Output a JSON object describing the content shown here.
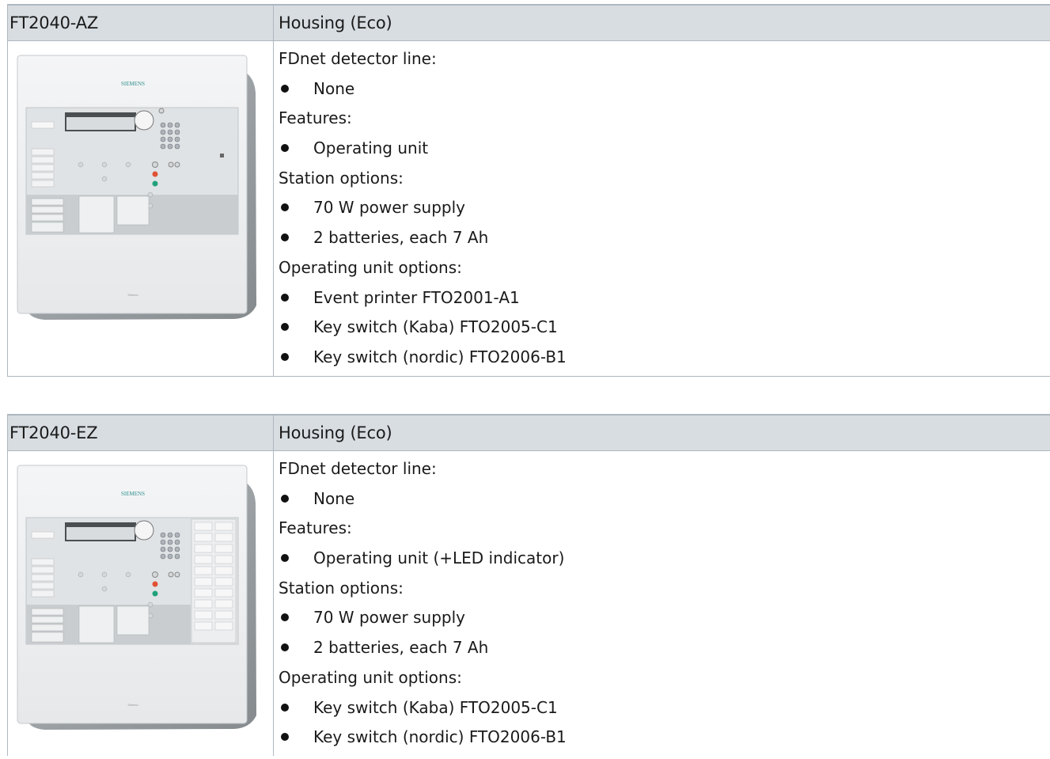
{
  "tables": [
    {
      "model": "FT2040-AZ",
      "housing": "Housing (Eco)",
      "image_alt": "Siemens fire control panel",
      "brand": "SIEMENS",
      "lines": [
        {
          "type": "heading",
          "text": "FDnet detector line:"
        },
        {
          "type": "bullet",
          "text": "None"
        },
        {
          "type": "heading",
          "text": "Features:"
        },
        {
          "type": "bullet",
          "text": "Operating unit"
        },
        {
          "type": "heading",
          "text": "Station options:"
        },
        {
          "type": "bullet",
          "text": "70 W power supply"
        },
        {
          "type": "bullet",
          "text": "2 batteries, each 7 Ah"
        },
        {
          "type": "heading",
          "text": "Operating unit options:"
        },
        {
          "type": "bullet",
          "text": "Event printer FTO2001-A1"
        },
        {
          "type": "bullet",
          "text": "Key switch (Kaba) FTO2005-C1"
        },
        {
          "type": "bullet",
          "text": "Key switch (nordic) FTO2006-B1"
        }
      ]
    },
    {
      "model": "FT2040-EZ",
      "housing": "Housing (Eco)",
      "image_alt": "Siemens fire control panel with LED indicator",
      "brand": "SIEMENS",
      "lines": [
        {
          "type": "heading",
          "text": "FDnet detector line:"
        },
        {
          "type": "bullet",
          "text": "None"
        },
        {
          "type": "heading",
          "text": "Features:"
        },
        {
          "type": "bullet",
          "text": "Operating unit (+LED indicator)"
        },
        {
          "type": "heading",
          "text": "Station options:"
        },
        {
          "type": "bullet",
          "text": "70 W power supply"
        },
        {
          "type": "bullet",
          "text": "2 batteries, each 7 Ah"
        },
        {
          "type": "heading",
          "text": "Operating unit options:"
        },
        {
          "type": "bullet",
          "text": "Key switch (Kaba) FTO2005-C1"
        },
        {
          "type": "bullet",
          "text": "Key switch (nordic) FTO2006-B1"
        }
      ]
    }
  ]
}
